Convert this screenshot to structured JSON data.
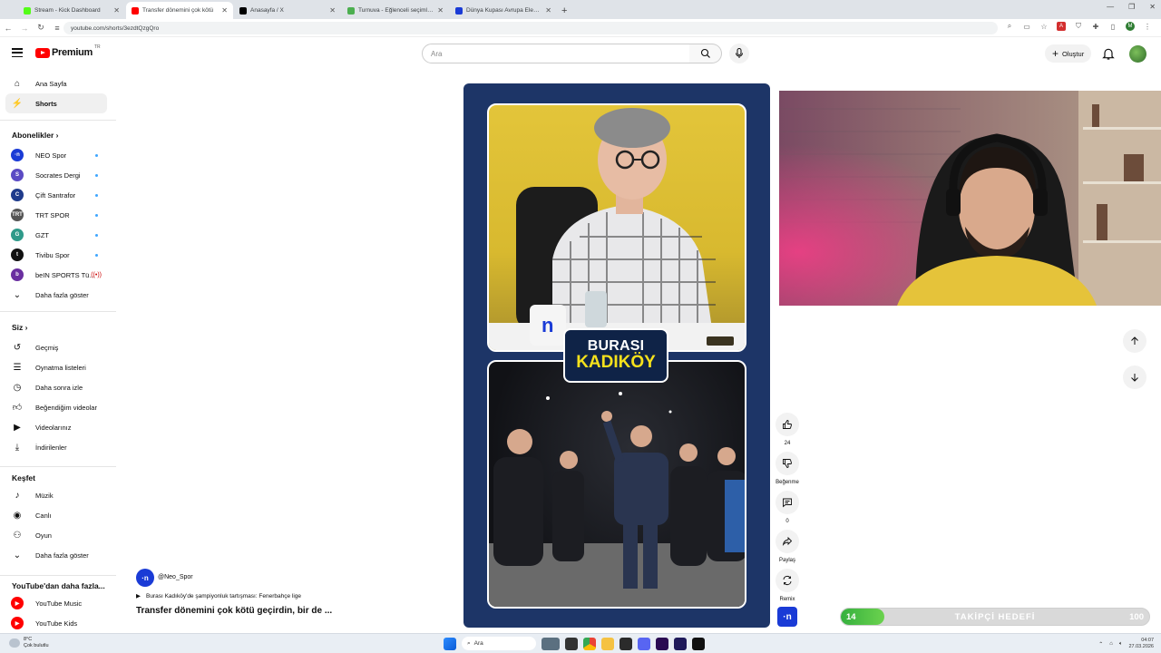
{
  "browser": {
    "tabs": [
      {
        "title": "Stream - Kick Dashboard",
        "color": "#53fc18"
      },
      {
        "title": "Transfer dönemini çok kötü",
        "color": "#ff0000"
      },
      {
        "title": "Anasayfa / X",
        "color": "#000000"
      },
      {
        "title": "Turnuva - Eğlenceli seçimler yap",
        "color": "#4caf50"
      },
      {
        "title": "Dünya Kupası Avrupa Elemeleri",
        "color": "#1a3bd6"
      }
    ],
    "url": "youtube.com/shorts/3ezdtQzgQro"
  },
  "header": {
    "brand": "Premium",
    "country": "TR",
    "search_placeholder": "Ara",
    "create_label": "Oluştur"
  },
  "sidebar": {
    "main": [
      {
        "label": "Ana Sayfa",
        "icon": "home-icon"
      },
      {
        "label": "Shorts",
        "icon": "shorts-icon"
      }
    ],
    "subs_title": "Abonelikler",
    "subs": [
      {
        "label": "NEO Spor",
        "color": "#1a3bd6",
        "mark": "·n"
      },
      {
        "label": "Socrates Dergi",
        "color": "#5b4bc4",
        "mark": "S"
      },
      {
        "label": "Çift Santrafor",
        "color": "#1f3b8c",
        "mark": "C"
      },
      {
        "label": "TRT SPOR",
        "color": "#555555",
        "mark": "TRT"
      },
      {
        "label": "GZT",
        "color": "#2f9a8a",
        "mark": "G"
      },
      {
        "label": "Tivibu Spor",
        "color": "#111111",
        "mark": "t"
      },
      {
        "label": "beIN SPORTS Tü...",
        "color": "#6a2fa0",
        "mark": "b"
      }
    ],
    "show_more": "Daha fazla göster",
    "you_title": "Siz",
    "you": [
      {
        "label": "Geçmiş",
        "icon": "history-icon"
      },
      {
        "label": "Oynatma listeleri",
        "icon": "playlist-icon"
      },
      {
        "label": "Daha sonra izle",
        "icon": "clock-icon"
      },
      {
        "label": "Beğendiğim videolar",
        "icon": "like-icon"
      },
      {
        "label": "Videolarınız",
        "icon": "video-icon"
      },
      {
        "label": "İndirilenler",
        "icon": "download-icon"
      }
    ],
    "explore_title": "Keşfet",
    "explore": [
      {
        "label": "Müzik",
        "icon": "music-icon"
      },
      {
        "label": "Canlı",
        "icon": "live-icon"
      },
      {
        "label": "Oyun",
        "icon": "game-icon"
      },
      {
        "label": "Daha fazla göster",
        "icon": "chevron-down-icon"
      }
    ],
    "more_title": "YouTube'dan daha fazla...",
    "more": [
      {
        "label": "YouTube Music",
        "color": "#ff0000"
      },
      {
        "label": "YouTube Kids",
        "color": "#ff0000"
      }
    ]
  },
  "short": {
    "overlay_line1": "BURASI",
    "overlay_line2": "KADIKÖY",
    "channel": "@Neo_Spor",
    "song": "Burası Kadıköy'de şampiyonluk tartışması: Fenerbahçe lige",
    "title": "Transfer dönemini çok kötü geçirdin, bir de ...",
    "likes": "24",
    "dislike_label": "Beğenme",
    "comments": "0",
    "share_label": "Paylaş",
    "remix_label": "Remix"
  },
  "goal": {
    "current": "14",
    "label": "TAKİPÇİ HEDEFİ",
    "max": "100",
    "fraction": 0.14
  },
  "taskbar": {
    "temp": "8°C",
    "weather": "Çok bulutlu",
    "search": "Ara",
    "time": "04:07",
    "date": "27.03.2026"
  }
}
